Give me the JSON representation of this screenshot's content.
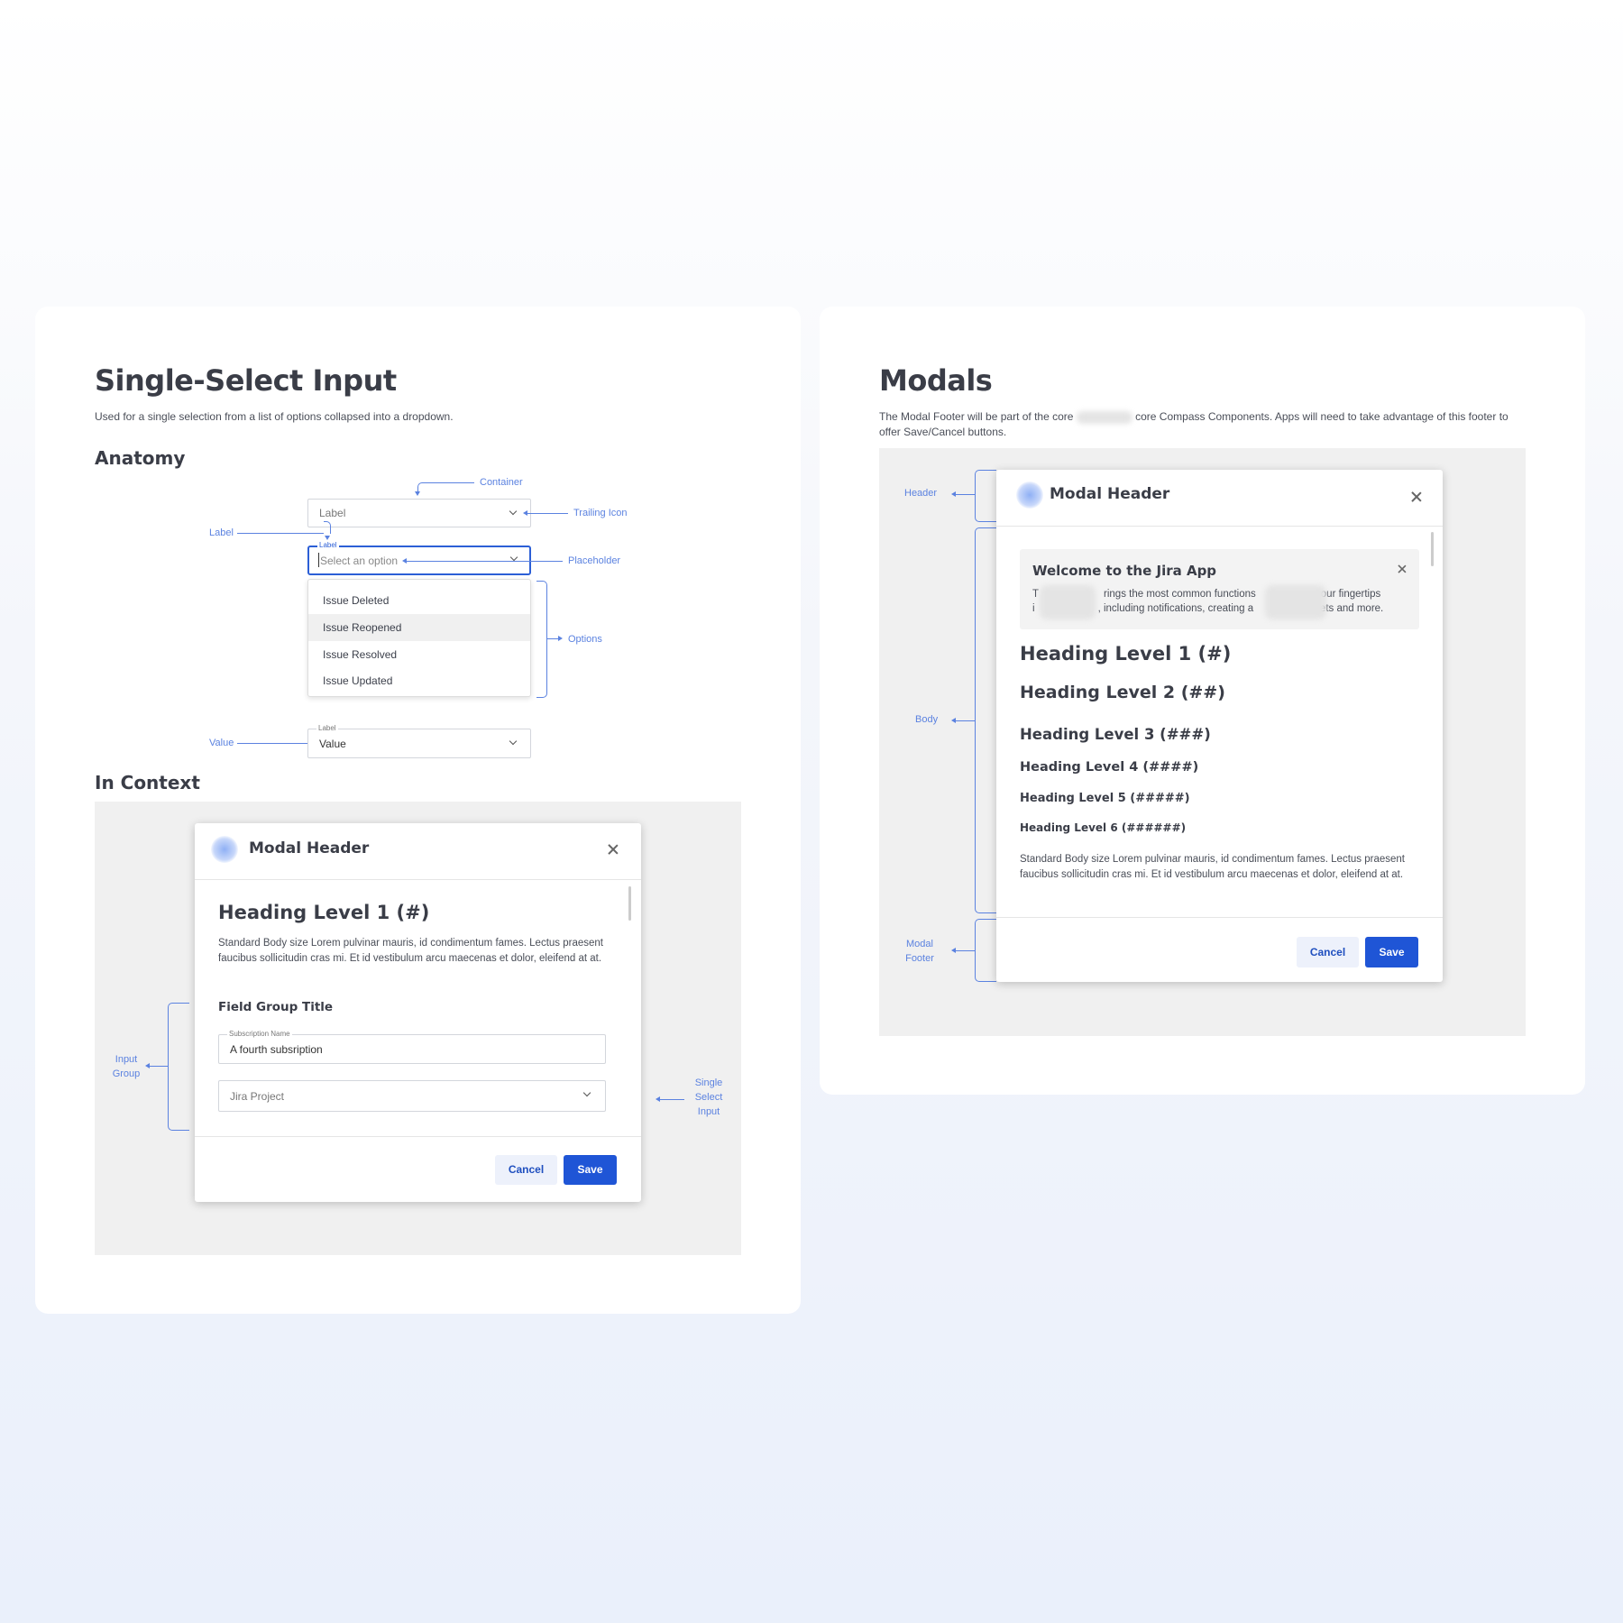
{
  "single_select": {
    "title": "Single-Select Input",
    "description": "Used for a single selection from a list of options collapsed into a dropdown.",
    "anatomy_heading": "Anatomy",
    "annotations": {
      "container": "Container",
      "trailing_icon": "Trailing Icon",
      "label": "Label",
      "placeholder": "Placeholder",
      "options": "Options",
      "value": "Value"
    },
    "collapsed_field": {
      "placeholder": "Label"
    },
    "active_field": {
      "label": "Label",
      "placeholder": "Select an option"
    },
    "options": [
      "Issue Deleted",
      "Issue Reopened",
      "Issue Resolved",
      "Issue Updated"
    ],
    "highlighted_option": "Issue Reopened",
    "value_field": {
      "label": "Label",
      "value": "Value"
    },
    "in_context_heading": "In Context",
    "context_modal": {
      "header": "Modal Header",
      "heading": "Heading Level 1 (#)",
      "body": "Standard Body size Lorem pulvinar mauris, id condimentum fames. Lectus praesent faucibus sollicitudin cras mi. Et id vestibulum arcu maecenas et dolor, eleifend at at.",
      "field_group_title": "Field Group Title",
      "subscription_label": "Subscription Name",
      "subscription_value": "A fourth subsription",
      "select_placeholder": "Jira Project",
      "cancel": "Cancel",
      "save": "Save"
    },
    "context_annotations": {
      "input_group": [
        "Input",
        "Group"
      ],
      "single_select_input": [
        "Single",
        "Select",
        "Input"
      ]
    }
  },
  "modals": {
    "title": "Modals",
    "description_parts": [
      "The Modal Footer will be part of the core",
      "core Compass Components. Apps will need to take advantage of this footer to offer Save/Cancel buttons."
    ],
    "annotations": {
      "header": "Header",
      "body": "Body",
      "footer": [
        "Modal",
        "Footer"
      ]
    },
    "modal": {
      "header": "Modal Header",
      "banner_title": "Welcome to the Jira App",
      "banner_line1_parts": [
        "T",
        "rings the most common functions",
        "our fingertips"
      ],
      "banner_line2_parts": [
        "i",
        ", including notifications, creating a",
        "kets and more."
      ],
      "headings": [
        "Heading Level 1 (#)",
        "Heading Level 2 (##)",
        "Heading Level 3 (###)",
        "Heading Level 4 (####)",
        "Heading Level 5 (#####)",
        "Heading Level 6 (######)"
      ],
      "body": "Standard Body size Lorem pulvinar mauris, id condimentum fames. Lectus praesent faucibus sollicitudin cras mi. Et id vestibulum arcu maecenas et dolor, eleifend at at.",
      "cancel": "Cancel",
      "save": "Save"
    }
  },
  "colors": {
    "accent": "#5b82e0",
    "primary": "#1f55d6",
    "panel_bg": "#f0f0f0"
  }
}
